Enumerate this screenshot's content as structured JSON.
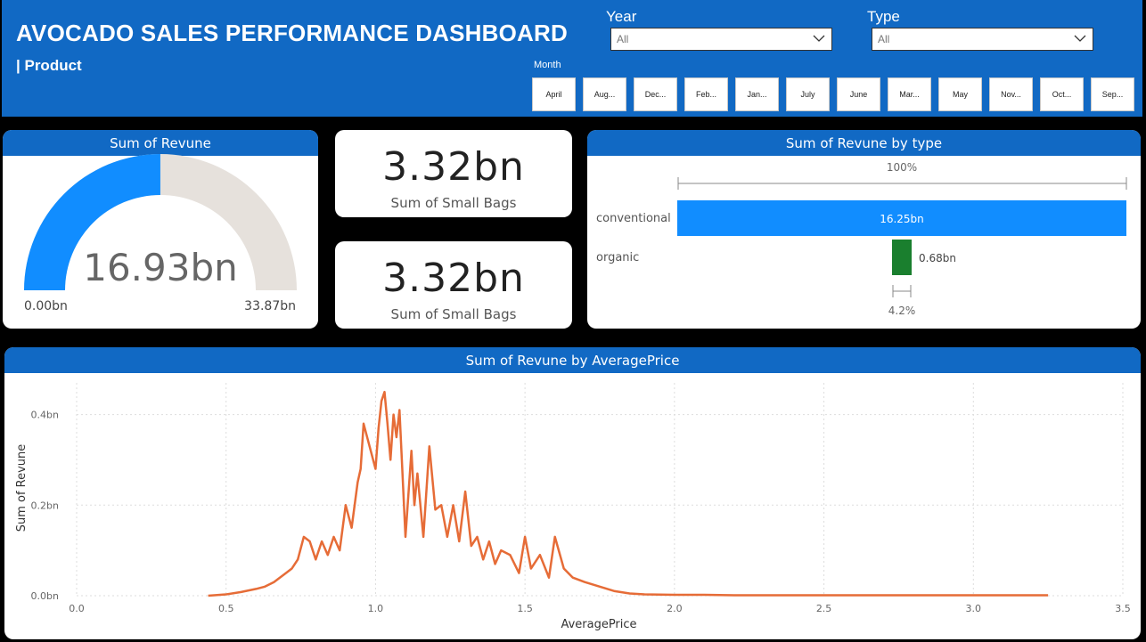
{
  "header": {
    "title": "AVOCADO SALES PERFORMANCE DASHBOARD",
    "subtitle": "| Product",
    "year_label": "Year",
    "year_value": "All",
    "type_label": "Type",
    "type_value": "All",
    "month_label": "Month",
    "months": [
      "April",
      "Aug...",
      "Dec...",
      "Feb...",
      "Jan...",
      "July",
      "June",
      "Mar...",
      "May",
      "Nov...",
      "Oct...",
      "Sep..."
    ]
  },
  "colors": {
    "brand": "#1169C4",
    "gauge_fill": "#118DFF",
    "gauge_track": "#E6E1DC",
    "organic": "#1A7F2E",
    "line": "#E66C37"
  },
  "gauge": {
    "title": "Sum of Revune",
    "value_label": "16.93bn",
    "min_label": "0.00bn",
    "max_label": "33.87bn",
    "value": 16.93,
    "min": 0,
    "max": 33.87
  },
  "kpi1": {
    "value": "3.32bn",
    "label": "Sum of Small Bags"
  },
  "kpi2": {
    "value": "3.32bn",
    "label": "Sum of Small Bags"
  },
  "by_type": {
    "title": "Sum of Revune by type",
    "top_pct": "100%",
    "bottom_pct": "4.2%",
    "rows": [
      {
        "category": "conventional",
        "value": 16.25,
        "label": "16.25bn"
      },
      {
        "category": "organic",
        "value": 0.68,
        "label": "0.68bn"
      }
    ]
  },
  "chart_data": {
    "type": "line",
    "title": "Sum of Revune by AveragePrice",
    "xlabel": "AveragePrice",
    "ylabel": "Sum of Revune",
    "xlim": [
      0,
      3.5
    ],
    "ylim": [
      0,
      0.47
    ],
    "x_ticks": [
      "0.0",
      "0.5",
      "1.0",
      "1.5",
      "2.0",
      "2.5",
      "3.0",
      "3.5"
    ],
    "y_ticks": [
      "0.0bn",
      "0.2bn",
      "0.4bn"
    ],
    "grid": true,
    "series": [
      {
        "x": [
          0.44,
          0.5,
          0.55,
          0.6,
          0.63,
          0.66,
          0.7,
          0.72,
          0.74,
          0.76,
          0.78,
          0.8,
          0.82,
          0.84,
          0.86,
          0.88,
          0.9,
          0.92,
          0.94,
          0.95,
          0.96,
          0.98,
          1.0,
          1.01,
          1.02,
          1.03,
          1.04,
          1.05,
          1.06,
          1.07,
          1.08,
          1.1,
          1.12,
          1.13,
          1.14,
          1.16,
          1.18,
          1.2,
          1.22,
          1.24,
          1.26,
          1.28,
          1.3,
          1.32,
          1.34,
          1.36,
          1.38,
          1.4,
          1.42,
          1.45,
          1.48,
          1.5,
          1.52,
          1.55,
          1.58,
          1.6,
          1.63,
          1.66,
          1.7,
          1.75,
          1.8,
          1.85,
          1.9,
          2.0,
          2.1,
          2.2,
          2.5,
          3.0,
          3.25
        ],
        "y": [
          0.0,
          0.003,
          0.008,
          0.015,
          0.02,
          0.03,
          0.05,
          0.06,
          0.08,
          0.13,
          0.12,
          0.08,
          0.12,
          0.09,
          0.13,
          0.1,
          0.2,
          0.15,
          0.25,
          0.28,
          0.38,
          0.33,
          0.28,
          0.37,
          0.43,
          0.45,
          0.38,
          0.3,
          0.4,
          0.35,
          0.41,
          0.13,
          0.32,
          0.2,
          0.27,
          0.13,
          0.33,
          0.19,
          0.2,
          0.13,
          0.2,
          0.12,
          0.23,
          0.11,
          0.13,
          0.08,
          0.12,
          0.07,
          0.1,
          0.09,
          0.05,
          0.13,
          0.06,
          0.09,
          0.04,
          0.13,
          0.06,
          0.04,
          0.03,
          0.02,
          0.01,
          0.005,
          0.003,
          0.002,
          0.002,
          0.001,
          0.001,
          0.001,
          0.001
        ]
      }
    ]
  }
}
